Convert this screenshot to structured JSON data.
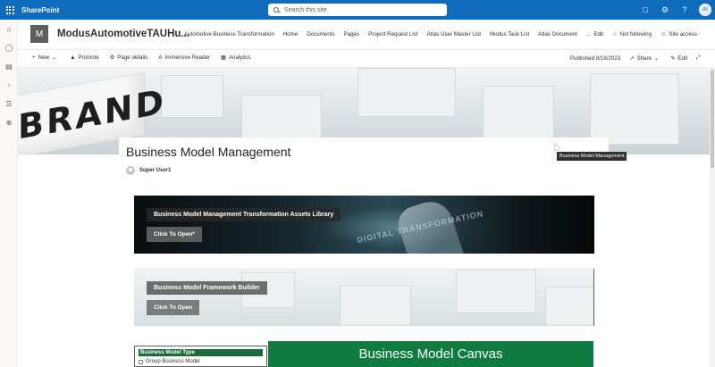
{
  "suite": {
    "brand": "SharePoint",
    "search_placeholder": "Search this site",
    "avatar_initials": "AI"
  },
  "site": {
    "logo_letter": "M",
    "title": "ModusAutomotiveTAUHu...",
    "nav": [
      "Automotive Business Transformation",
      "Home",
      "Documents",
      "Pages",
      "Project Request List",
      "Atlas User Master List",
      "Modus Task List",
      "Atlas Document",
      "..."
    ],
    "edit_label": "Edit",
    "follow_label": "Not following",
    "access_label": "Site access"
  },
  "commandbar": {
    "new_label": "New",
    "promote_label": "Promote",
    "page_details_label": "Page details",
    "immersive_reader_label": "Immersive Reader",
    "analytics_label": "Analytics",
    "published_label": "Published 8/18/2023",
    "share_label": "Share",
    "edit_label": "Edit"
  },
  "hero": {
    "sign_text": "BRAND"
  },
  "page": {
    "title": "Business Model Management",
    "author": "Super User1",
    "tooltip": "Business Model Management"
  },
  "tiles": [
    {
      "title": "Business Model Management Transformation Assets Library",
      "button": "Click To Open*",
      "overlay_text": "DIGITAL TRANSFORMATION"
    },
    {
      "title": "Business Model Framework Builder",
      "button": "Click To Open"
    }
  ],
  "bottom": {
    "type_header": "Business Model Type",
    "type_option": "Group Business Model",
    "canvas_title": "Business Model Canvas"
  },
  "colors": {
    "suitebar": "#0f6cbd",
    "canvas_green": "#107c41",
    "type_header_green": "#1b6b3a"
  }
}
